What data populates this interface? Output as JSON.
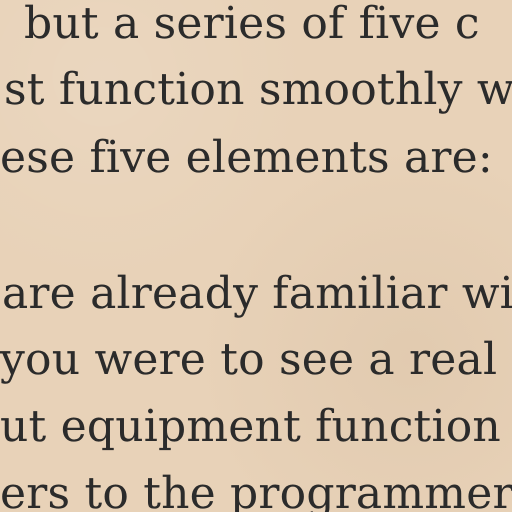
{
  "document": {
    "lines": [
      "but a series of five c",
      "st function smoothly w",
      "ese five elements are:",
      "are already familiar wit",
      "you were to see a real",
      "ut equipment function",
      "ers to the programmer"
    ]
  }
}
